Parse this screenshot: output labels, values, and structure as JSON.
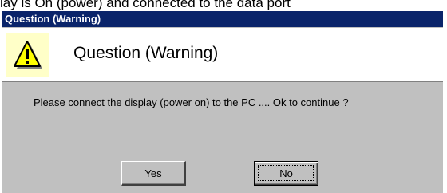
{
  "background": {
    "caption": "lay is On (power) and connected to the data port"
  },
  "dialog": {
    "title": "Question (Warning)",
    "header": "Question (Warning)",
    "icon": "warning-icon",
    "message": "Please connect the display (power on) to the PC .... Ok to continue ?",
    "buttons": {
      "yes": "Yes",
      "no": "No"
    },
    "colors": {
      "titlebar": "#0a246a",
      "face": "#c0c0c0",
      "icon_bg": "#ffffc8",
      "warning_yellow": "#ffff00"
    }
  }
}
